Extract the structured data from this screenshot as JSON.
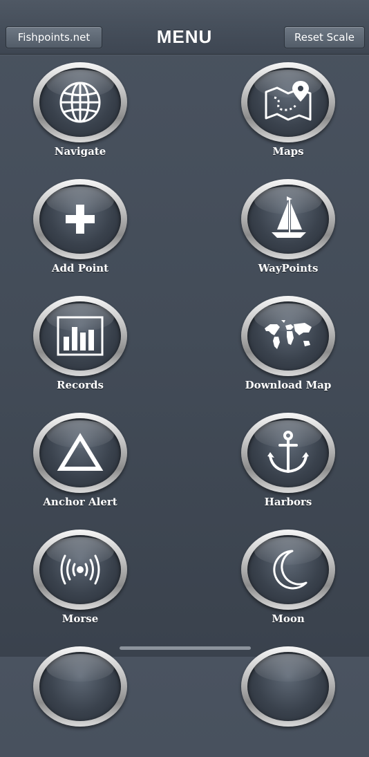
{
  "navbar": {
    "left_button": "Fishpoints.net",
    "title": "MENU",
    "right_button": "Reset Scale"
  },
  "menu": {
    "items": [
      {
        "label": "Navigate",
        "icon": "globe-icon"
      },
      {
        "label": "Maps",
        "icon": "map-pin-icon"
      },
      {
        "label": "Add Point",
        "icon": "plus-icon"
      },
      {
        "label": "WayPoints",
        "icon": "sailboat-icon"
      },
      {
        "label": "Records",
        "icon": "bar-chart-icon"
      },
      {
        "label": "Download Map",
        "icon": "world-map-icon"
      },
      {
        "label": "Anchor Alert",
        "icon": "triangle-icon"
      },
      {
        "label": "Harbors",
        "icon": "anchor-icon"
      },
      {
        "label": "Morse",
        "icon": "signal-waves-icon"
      },
      {
        "label": "Moon",
        "icon": "moon-icon"
      }
    ]
  },
  "colors": {
    "background": "#434c58",
    "button_ring": "#c6c6c6",
    "label_text": "#ffffff"
  }
}
